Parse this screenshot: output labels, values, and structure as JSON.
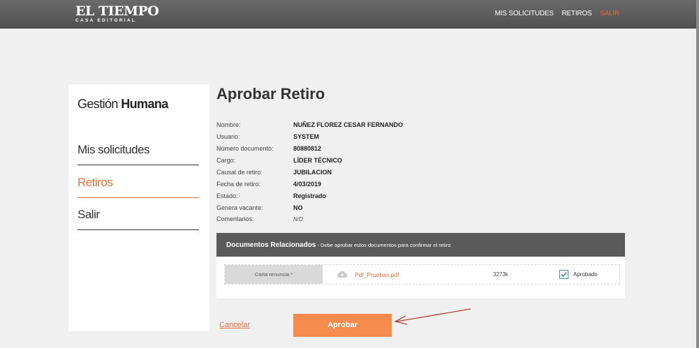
{
  "header": {
    "logo_main": "EL TIEMPO",
    "logo_sub": "CASA EDITORIAL",
    "nav": [
      {
        "label": "MIS SOLICITUDES",
        "active": false
      },
      {
        "label": "RETIROS",
        "active": false
      },
      {
        "label": "SALIR",
        "active": true
      }
    ]
  },
  "sidebar": {
    "title_light": "Gestión",
    "title_bold": "Humana",
    "items": [
      {
        "label": "Mis solicitudes",
        "active": false
      },
      {
        "label": "Retiros",
        "active": true
      },
      {
        "label": "Salir",
        "active": false
      }
    ]
  },
  "main": {
    "title": "Aprobar Retiro",
    "fields": [
      {
        "label": "Nombre:",
        "value": "NUÑEZ FLOREZ CESAR FERNANDO"
      },
      {
        "label": "Usuario:",
        "value": "SYSTEM"
      },
      {
        "label": "Número documento:",
        "value": "80880812"
      },
      {
        "label": "Cargo:",
        "value": "LÍDER TÉCNICO"
      },
      {
        "label": "Causal de retiro:",
        "value": "JUBILACION"
      },
      {
        "label": "Fecha de retiro:",
        "value": "4/03/2019"
      },
      {
        "label": "Estado:",
        "value": "Registrado"
      },
      {
        "label": "Genera vacante:",
        "value": "NO"
      },
      {
        "label": "Comentarios:",
        "value": "N/D"
      }
    ],
    "documents": {
      "heading": "Documentos Relacionados",
      "note": " - Debe aprobar estos documentos para confirmar el retiro",
      "rows": [
        {
          "label": "Carta renuncia *",
          "file": "Pdf_Pruebas.pdf",
          "size": "3273k",
          "check_label": "Aprobado",
          "checked": true
        }
      ]
    },
    "cancel_label": "Cancelar",
    "approve_label": "Aprobar"
  },
  "colors": {
    "accent": "#e8733a",
    "button": "#f58b4c",
    "header_bg": "#5a5a5a",
    "checkbox": "#2f8fbf"
  }
}
